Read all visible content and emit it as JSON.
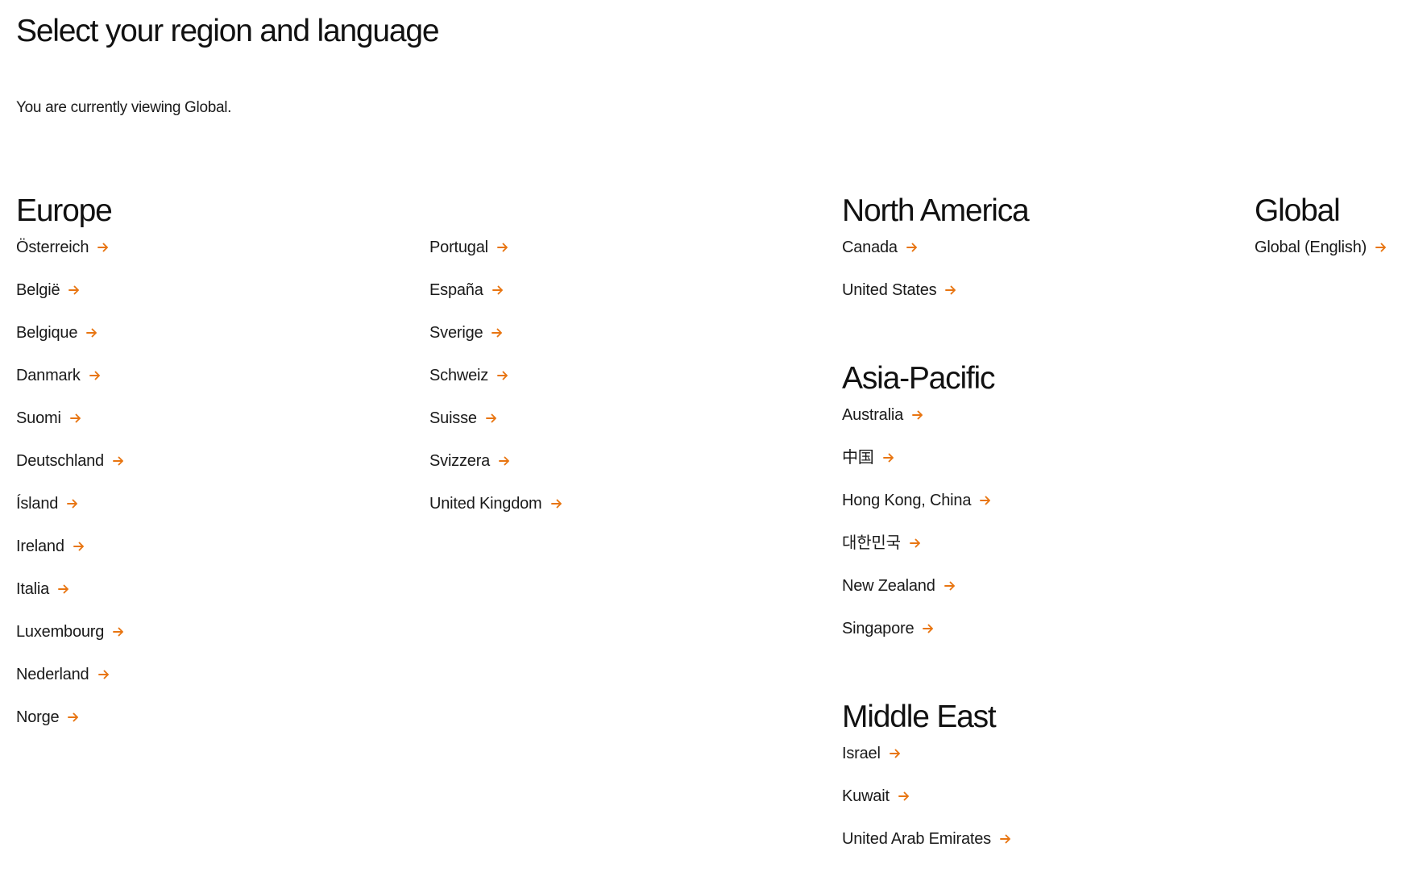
{
  "page": {
    "title": "Select your region and language",
    "current_note": "You are currently viewing Global."
  },
  "theme": {
    "accent_color": "#e87511",
    "text_color": "#1a1a1a",
    "arrow_icon": "arrow-right-icon"
  },
  "regions": {
    "europe": {
      "heading": "Europe",
      "col1": [
        "Österreich",
        "België",
        "Belgique",
        "Danmark",
        "Suomi",
        "Deutschland",
        "Ísland",
        "Ireland",
        "Italia",
        "Luxembourg",
        "Nederland",
        "Norge"
      ],
      "col2": [
        "Portugal",
        "España",
        "Sverige",
        "Schweiz",
        "Suisse",
        "Svizzera",
        "United Kingdom"
      ]
    },
    "north_america": {
      "heading": "North America",
      "items": [
        "Canada",
        "United States"
      ]
    },
    "asia_pacific": {
      "heading": "Asia-Pacific",
      "items": [
        "Australia",
        "中国",
        "Hong Kong, China",
        "대한민국",
        "New Zealand",
        "Singapore"
      ]
    },
    "middle_east": {
      "heading": "Middle East",
      "items": [
        "Israel",
        "Kuwait",
        "United Arab Emirates"
      ]
    },
    "global": {
      "heading": "Global",
      "items": [
        "Global (English)"
      ]
    }
  }
}
